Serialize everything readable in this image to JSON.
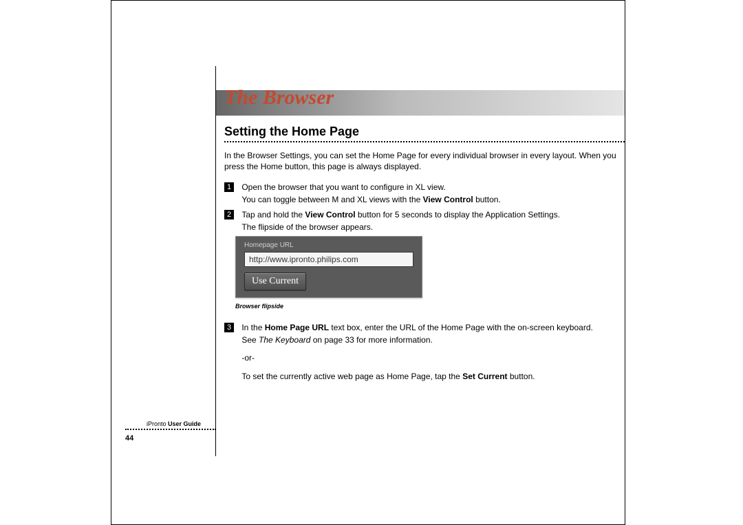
{
  "chapter_title": "The Browser",
  "section_title": "Setting the Home Page",
  "intro": "In the Browser Settings, you can set the Home Page for every individual browser in every layout. When you press the Home button, this page is always displayed.",
  "steps": {
    "s1": {
      "num": "1",
      "line1": "Open the browser that you want to configure in XL view.",
      "line2a": "You can toggle between M and XL views with the ",
      "line2b": "View Control",
      "line2c": " button."
    },
    "s2": {
      "num": "2",
      "line1a": "Tap and hold the ",
      "line1b": "View Control",
      "line1c": " button for 5 seconds to display the Application Settings.",
      "line2": "The flipside of the browser appears."
    },
    "s3": {
      "num": "3",
      "line1a": "In the ",
      "line1b": "Home Page URL",
      "line1c": " text box, enter the URL of the Home Page with the on-screen keyboard.",
      "line2a": "See ",
      "line2b": "The Keyboard",
      "line2c": " on page 33 for more information.",
      "or": "-or-",
      "line3a": "To set the currently active web page as Home Page, tap the ",
      "line3b": "Set Current",
      "line3c": " button."
    }
  },
  "screenshot": {
    "label": "Homepage URL",
    "value": "http://www.ipronto.philips.com",
    "button": "Use Current",
    "caption": "Browser flipside"
  },
  "footer": {
    "product": "iPronto",
    "guide": " User Guide",
    "page": "44"
  }
}
